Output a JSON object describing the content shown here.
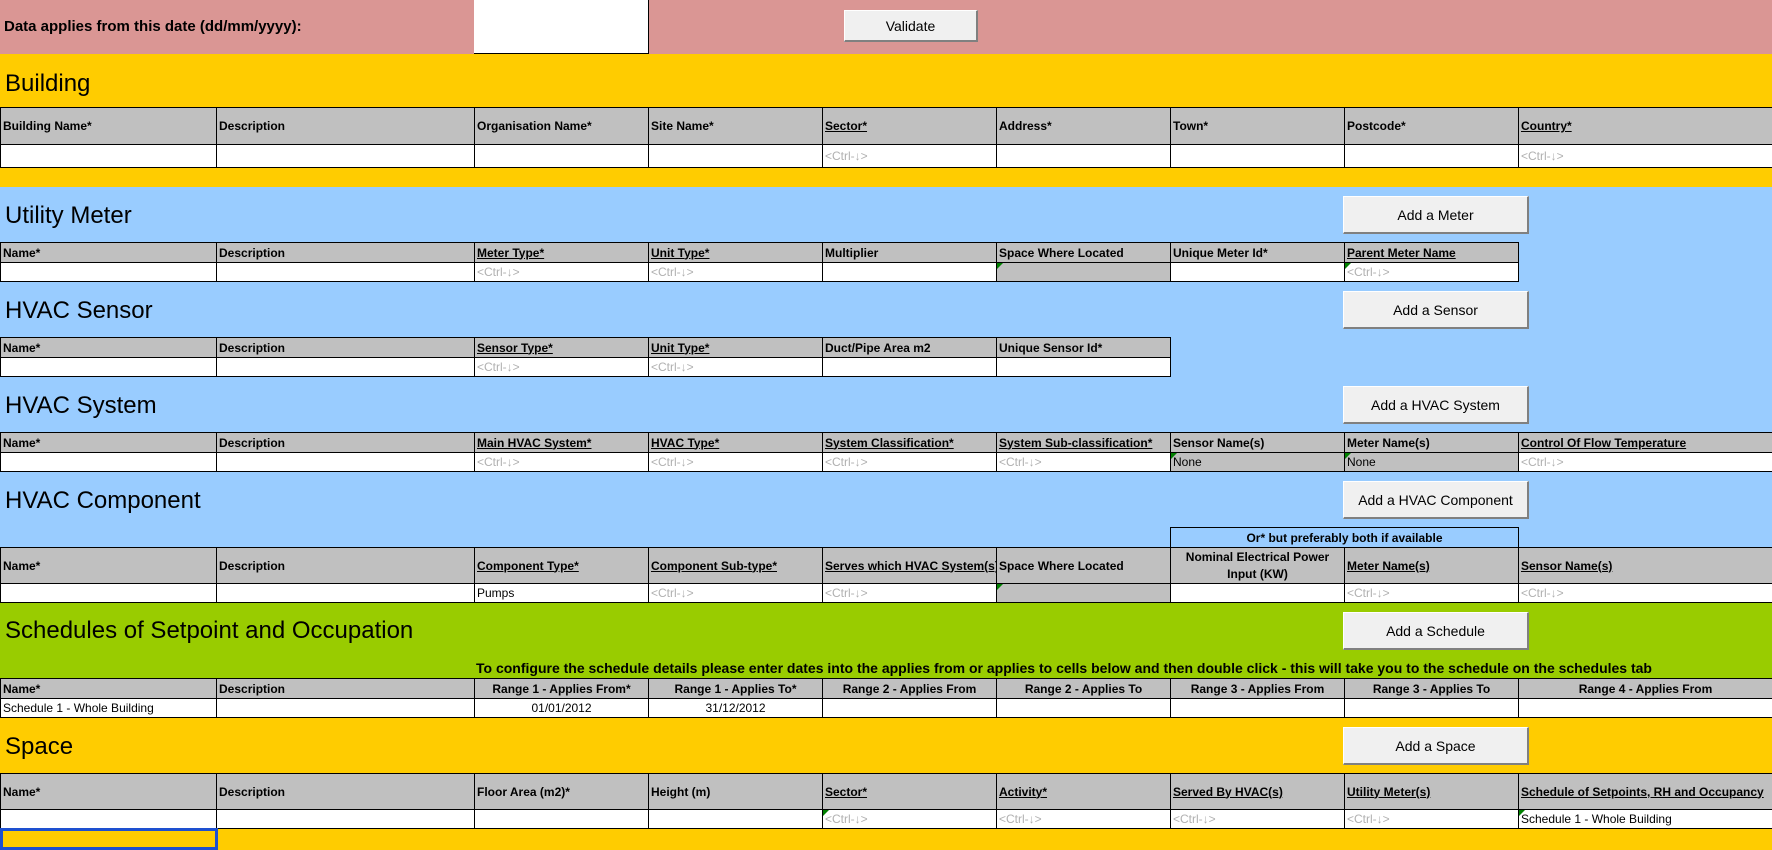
{
  "header": {
    "date_label": "Data applies from this date (dd/mm/yyyy):",
    "date_value": "",
    "validate_button": "Validate"
  },
  "placeholder": "<Ctrl-↓>",
  "colors": {
    "header_band": "#da9694",
    "building_band": "#ffcc00",
    "equipment_band": "#99ccff",
    "schedule_band": "#99cc00",
    "column_header": "#c0c0c0"
  },
  "building": {
    "title": "Building",
    "columns": [
      "Building Name*",
      "Description",
      "Organisation Name*",
      "Site Name*",
      "Sector*",
      "Address*",
      "Town*",
      "Postcode*",
      "Country*"
    ],
    "values": [
      "",
      "",
      "",
      "",
      "<Ctrl-↓>",
      "",
      "",
      "",
      "<Ctrl-↓>"
    ]
  },
  "utility_meter": {
    "title": "Utility Meter",
    "add_button": "Add a Meter",
    "columns": [
      "Name*",
      "Description",
      "Meter Type*",
      "Unit Type*",
      "Multiplier",
      "Space Where Located",
      "Unique Meter Id*",
      "Parent Meter Name"
    ],
    "values": [
      "",
      "",
      "<Ctrl-↓>",
      "<Ctrl-↓>",
      "",
      "",
      "",
      "<Ctrl-↓>"
    ]
  },
  "hvac_sensor": {
    "title": "HVAC Sensor",
    "add_button": "Add a Sensor",
    "columns": [
      "Name*",
      "Description",
      "Sensor Type*",
      "Unit Type*",
      "Duct/Pipe Area m2",
      "Unique Sensor Id*"
    ],
    "values": [
      "",
      "",
      "<Ctrl-↓>",
      "<Ctrl-↓>",
      "",
      ""
    ]
  },
  "hvac_system": {
    "title": "HVAC System",
    "add_button": "Add a HVAC System",
    "columns": [
      "Name*",
      "Description",
      "Main HVAC System*",
      "HVAC Type*",
      "System Classification*",
      "System Sub-classification*",
      "Sensor Name(s)",
      "Meter Name(s)",
      "Control Of Flow Temperature"
    ],
    "values": [
      "",
      "",
      "<Ctrl-↓>",
      "<Ctrl-↓>",
      "<Ctrl-↓>",
      "<Ctrl-↓>",
      "None",
      "None",
      "<Ctrl-↓>"
    ]
  },
  "hvac_component": {
    "title": "HVAC Component",
    "add_button": "Add a HVAC Component",
    "group_note": "Or* but preferably both if available",
    "columns": [
      "Name*",
      "Description",
      "Component Type*",
      "Component Sub-type*",
      "Serves which HVAC System(s)*",
      "Space Where Located",
      "Nominal Electrical Power Input (KW)",
      "Meter Name(s)",
      "Sensor Name(s)"
    ],
    "values": [
      "",
      "",
      "Pumps",
      "<Ctrl-↓>",
      "<Ctrl-↓>",
      "",
      "",
      "<Ctrl-↓>",
      "<Ctrl-↓>"
    ]
  },
  "schedules": {
    "title": "Schedules of Setpoint and Occupation",
    "add_button": "Add a Schedule",
    "instruction": "To configure the schedule details please enter dates into the applies from or applies to cells below and then double click - this will take you to the schedule on the schedules tab",
    "columns": [
      "Name*",
      "Description",
      "Range 1 - Applies From*",
      "Range 1 - Applies To*",
      "Range 2 - Applies From",
      "Range 2 - Applies To",
      "Range 3 - Applies From",
      "Range 3 - Applies To",
      "Range 4 - Applies From"
    ],
    "values": [
      "Schedule 1 - Whole Building",
      "",
      "01/01/2012",
      "31/12/2012",
      "",
      "",
      "",
      "",
      ""
    ]
  },
  "space": {
    "title": "Space",
    "add_button": "Add a Space",
    "columns": [
      "Name*",
      "Description",
      "Floor Area (m2)*",
      "Height (m)",
      "Sector*",
      "Activity*",
      "Served By HVAC(s)",
      "Utility Meter(s)",
      "Schedule of Setpoints, RH and Occupancy"
    ],
    "values": [
      "",
      "",
      "",
      "",
      "<Ctrl-↓>",
      "<Ctrl-↓>",
      "<Ctrl-↓>",
      "<Ctrl-↓>",
      "Schedule 1 - Whole Building"
    ]
  }
}
